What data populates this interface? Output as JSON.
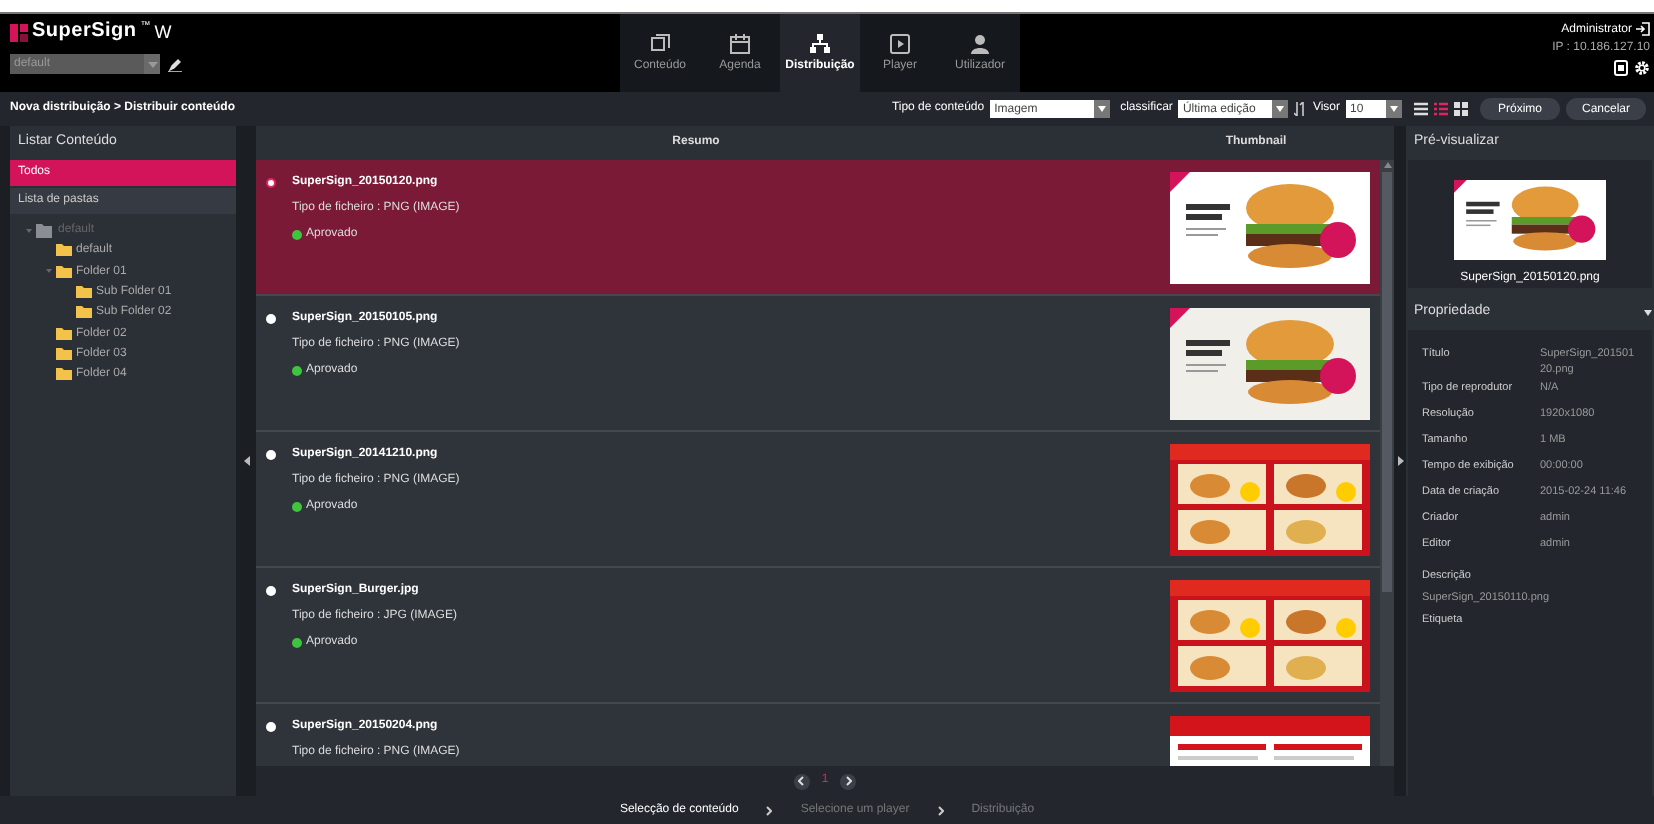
{
  "header": {
    "logo": "SuperSign",
    "logo_mark": "™",
    "logo_suffix": "W",
    "site_select": {
      "value": "default"
    },
    "nav": [
      {
        "label": "Conteúdo",
        "selected": false
      },
      {
        "label": "Agenda",
        "selected": false
      },
      {
        "label": "Distribuição",
        "selected": true
      },
      {
        "label": "Player",
        "selected": false
      },
      {
        "label": "Utilizador",
        "selected": false
      }
    ],
    "user": "Administrator",
    "ip": "IP : 10.186.127.10"
  },
  "breadcrumb": "Nova distribuição > Distribuir conteúdo",
  "toolbar": {
    "content_type_label": "Tipo de conteúdo",
    "content_type": "Imagem",
    "sort_label": "classificar",
    "sort": "Última edição",
    "view_label": "Visor",
    "view_count": "10",
    "view_modes": [
      {
        "selected": false
      },
      {
        "selected": true
      },
      {
        "selected": false
      }
    ],
    "buttons": [
      "Próximo",
      "Cancelar"
    ]
  },
  "left_panel": {
    "title": "Listar Conteúdo",
    "items": [
      {
        "label": "Todos",
        "selected": true
      },
      {
        "label": "Lista de pastas",
        "selected": false
      }
    ],
    "tree": [
      {
        "label": "default",
        "expanded": true,
        "children": [
          {
            "label": "default"
          },
          {
            "label": "Folder 01",
            "expanded": true,
            "children": [
              {
                "label": "Sub Folder 01"
              },
              {
                "label": "Sub Folder 02"
              }
            ]
          },
          {
            "label": "Folder 02"
          },
          {
            "label": "Folder 03"
          },
          {
            "label": "Folder 04"
          }
        ]
      }
    ]
  },
  "list": {
    "columns": [
      "Resumo",
      "Thumbnail"
    ],
    "rows": [
      {
        "name": "SuperSign_20150120.png",
        "type": "Tipo de ficheiro : PNG (IMAGE)",
        "status": "Aprovado",
        "selected": true
      },
      {
        "name": "SuperSign_20150105.png",
        "type": "Tipo de ficheiro : PNG (IMAGE)",
        "status": "Aprovado",
        "selected": false
      },
      {
        "name": "SuperSign_20141210.png",
        "type": "Tipo de ficheiro : PNG (IMAGE)",
        "status": "Aprovado",
        "selected": false
      },
      {
        "name": "SuperSign_Burger.jpg",
        "type": "Tipo de ficheiro : JPG (IMAGE)",
        "status": "Aprovado",
        "selected": false
      },
      {
        "name": "SuperSign_20150204.png",
        "type": "Tipo de ficheiro : PNG (IMAGE)",
        "selected": false
      }
    ],
    "page": "1"
  },
  "preview": {
    "title": "Pré-visualizar",
    "file": "SuperSign_20150120.png"
  },
  "properties": {
    "title": "Propriedade",
    "fields": [
      {
        "label": "Título",
        "value": "SuperSign_20150120.png"
      },
      {
        "label": "Tipo de reprodutor",
        "value": "N/A"
      },
      {
        "label": "Resolução",
        "value": "1920x1080"
      },
      {
        "label": "Tamanho",
        "value": "1 MB"
      },
      {
        "label": "Tempo de exibição",
        "value": "00:00:00"
      },
      {
        "label": "Data de criação",
        "value": "2015-02-24 11:46"
      },
      {
        "label": "Criador",
        "value": "admin"
      },
      {
        "label": "Editor",
        "value": "admin"
      }
    ],
    "description_label": "Descrição",
    "description": "SuperSign_20150110.png",
    "tag_label": "Etiqueta"
  },
  "steps": [
    {
      "label": "Selecção de conteúdo",
      "selected": true
    },
    {
      "label": "Selecione um player",
      "selected": false
    },
    {
      "label": "Distribuição",
      "selected": false
    }
  ]
}
